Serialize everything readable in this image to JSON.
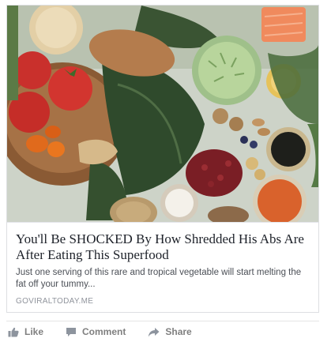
{
  "link_preview": {
    "image": "food-photo: vegetables, kale, tomatoes, sweet potato, salmon, beans, lentils, seeds and grains",
    "headline": "You'll Be SHOCKED By How Shredded His Abs Are After Eating This Superfood",
    "description": "Just one serving of this rare and tropical vegetable will start melting the fat off your tummy...",
    "domain": "GOVIRALTODAY.ME"
  },
  "actions": {
    "like_label": "Like",
    "comment_label": "Comment",
    "share_label": "Share",
    "like_icon": "thumbs-up-icon",
    "comment_icon": "speech-bubble-icon",
    "share_icon": "share-arrow-icon"
  },
  "colors": {
    "headline": "#1d2129",
    "description": "#4b4f56",
    "domain": "#90949c",
    "action_text": "#7f7f7f",
    "border": "#dddfe2"
  }
}
